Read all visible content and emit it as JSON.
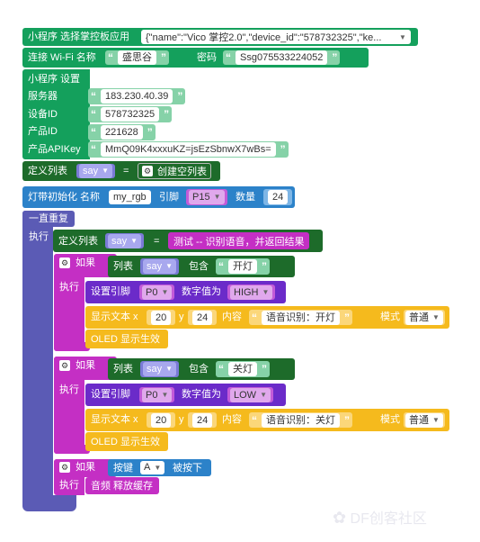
{
  "colors": {
    "wifi": "#14a05c",
    "define": "#1d6b2a",
    "rgb": "#2c82c9",
    "loop": "#5b5bb5",
    "if": "#c42fc4",
    "pin": "#6b2bc9",
    "oled": "#f5ba1d",
    "text": "#c42fc4"
  },
  "row1": {
    "label": "小程序 选择掌控板应用",
    "value": "{\"name\":\"Vico 掌控2.0\",\"device_id\":\"578732325\",\"ke..."
  },
  "row2": {
    "label": "连接 Wi-Fi 名称",
    "ssid": "盛思谷",
    "pwd_label": "密码",
    "pwd": "Ssg075533224052"
  },
  "settings": {
    "title": "小程序 设置",
    "server_label": "服务器",
    "server": "183.230.40.39",
    "device_label": "设备ID",
    "device": "578732325",
    "product_label": "产品ID",
    "product": "221628",
    "apikey_label": "产品APIKey",
    "apikey": "MmQ09K4xxxuKZ=jsEzSbnwX7wBs="
  },
  "define_list": {
    "label": "定义列表",
    "var": "say",
    "eq": "=",
    "create": "创建空列表"
  },
  "rgb": {
    "label": "灯带初始化 名称",
    "name": "my_rgb",
    "pin_label": "引脚",
    "pin": "P15",
    "count_label": "数量",
    "count": "24"
  },
  "loop": {
    "label": "一直重复",
    "exec": "执行"
  },
  "inner_define": {
    "label": "定义列表",
    "var": "say",
    "eq": "=",
    "value": "测试 -- 识别语音，并返回结果"
  },
  "if1": {
    "if": "如果",
    "list": "列表",
    "var": "say",
    "contains": "包含",
    "word": "开灯",
    "exec": "执行",
    "pin_label": "设置引脚",
    "pin": "P0",
    "digital": "数字值为",
    "level": "HIGH",
    "show_label": "显示文本 x",
    "x": "20",
    "y_label": "y",
    "y": "24",
    "content_label": "内容",
    "content": "语音识别：开灯",
    "mode_label": "模式",
    "mode": "普通",
    "oled": "OLED 显示生效"
  },
  "if2": {
    "if": "如果",
    "list": "列表",
    "var": "say",
    "contains": "包含",
    "word": "关灯",
    "exec": "执行",
    "pin_label": "设置引脚",
    "pin": "P0",
    "digital": "数字值为",
    "level": "LOW",
    "show_label": "显示文本 x",
    "x": "20",
    "y_label": "y",
    "y": "24",
    "content_label": "内容",
    "content": "语音识别：关灯",
    "mode_label": "模式",
    "mode": "普通",
    "oled": "OLED 显示生效"
  },
  "if3": {
    "if": "如果",
    "button_label": "按键",
    "button": "A",
    "pressed": "被按下",
    "exec": "执行",
    "audio": "音频 释放缓存"
  },
  "watermark": "DF创客社区"
}
